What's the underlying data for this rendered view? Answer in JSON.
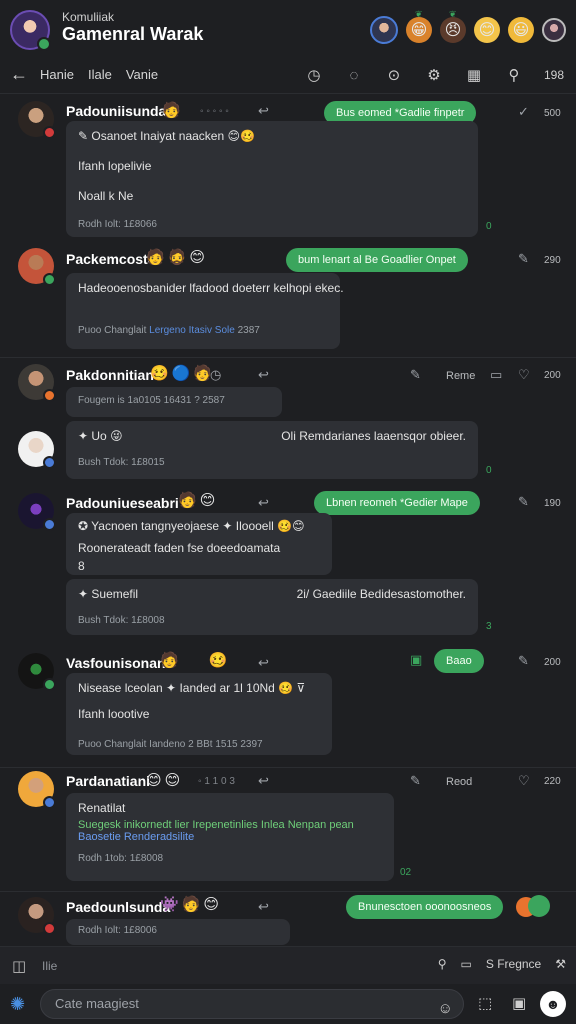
{
  "header": {
    "kicker": "Komuliiak",
    "title": "Gamenral Warak",
    "right_icons": [
      "avatar-ring",
      "grinning-sprout-face",
      "dark-sprout-face",
      "smiley-face",
      "grinning-face",
      "avatar-ring-small"
    ]
  },
  "toolbar": {
    "crumbs": [
      "Hanie",
      "Ilale",
      "Vanie"
    ],
    "tools": [
      "clock-icon",
      "chat-icon",
      "search-box-icon",
      "gear-icon",
      "grid-icon",
      "search-icon"
    ],
    "count": "198"
  },
  "messages": [
    {
      "username": "Padouniisunda",
      "emoji": [
        "🧑",
        "⚪"
      ],
      "meta": "◦ ◦ ◦ ◦ ◦",
      "pill": "Bus eomed *Gadlie finpetr",
      "right_count": "500",
      "lines": [
        "✎ Osanoet Inaiyat naacken 😊🥴",
        "Ifanh lopelivie",
        "Noall k Ne"
      ],
      "footer": "Rodh Iolt: 1£8066",
      "green_status": "0"
    },
    {
      "username": "Packemcoste",
      "emoji": [
        "🧑",
        "🧔",
        "😊"
      ],
      "pill": "bum lenart al Be Goadlier Onpet",
      "right_count": "290",
      "lines": [
        "Hadeooenosbanider lfadood doeterr kelhopi ekec."
      ],
      "footer_a": "Puoo  Changlait",
      "footer_b": "Lergeno Itasiv Sole",
      "footer_c": "2387"
    },
    {
      "username": "Pakdonnitian",
      "emoji": [
        "🥴",
        "🔵",
        "🧑"
      ],
      "actions": [
        "Reme",
        "200"
      ],
      "footer": "Fougem is 1a0105    16431 ? 2587"
    },
    {
      "label": "✦ Uo 😜",
      "right_text": "Oli Remdarianes laaensqor obieer.",
      "footer": "Bush Tdok: 1£8015",
      "green_status": "0"
    },
    {
      "username": "Padouniueseabri",
      "emoji": [
        "🧑",
        "😊"
      ],
      "pill": "Lbnen reomeh *Gedier Mape",
      "right_count": "190",
      "lines": [
        "✪ Yacnoen tangnyeojaese ✦ Iloooell 🥴😊",
        "Roonerateadt faden fse doeedoamata",
        "8"
      ],
      "sub_left": "✦ Suemefil",
      "sub_right": "2i/ Gaediile Bedidesastomother.",
      "footer": "Bush Tdok: 1£8008",
      "green_status": "3"
    },
    {
      "username": "Vasfounisonan",
      "emoji": [
        "🧑",
        "🥴"
      ],
      "pill": "Baao",
      "right_count": "200",
      "lines": [
        "Nisease lceolan ✦ Ianded ar 1l 10Nd 🥴 ⊽",
        "Ifanh loootive"
      ],
      "footer_a": "Puoo  Changlait",
      "footer_b": "Iandeno 2 BBt 1515",
      "footer_c": "2397"
    },
    {
      "username": "Pardanatiani",
      "emoji": [
        "😊",
        "😊"
      ],
      "meta": "◦ 1 1 0 3",
      "actions": [
        "Reod",
        "220"
      ],
      "lines": [
        "Renatilat",
        "Suegesk inikornedt lier Irepenetinlies Inlea Nenpan pean",
        "Baosetie Renderadsilite"
      ],
      "footer": "Rodh 1tob: 1£8008",
      "green_status": "02"
    },
    {
      "username": "Paedounlsunda",
      "emoji": [
        "👾",
        "🧑",
        "😊"
      ],
      "pill": "Bnunesctoen ooonoosneos",
      "footer": "Rodh Iolt: 1£8006"
    }
  ],
  "composer": {
    "top_placeholder": "Ilie",
    "top_right": "S Fregnce",
    "placeholder": "Cate maagiest"
  }
}
